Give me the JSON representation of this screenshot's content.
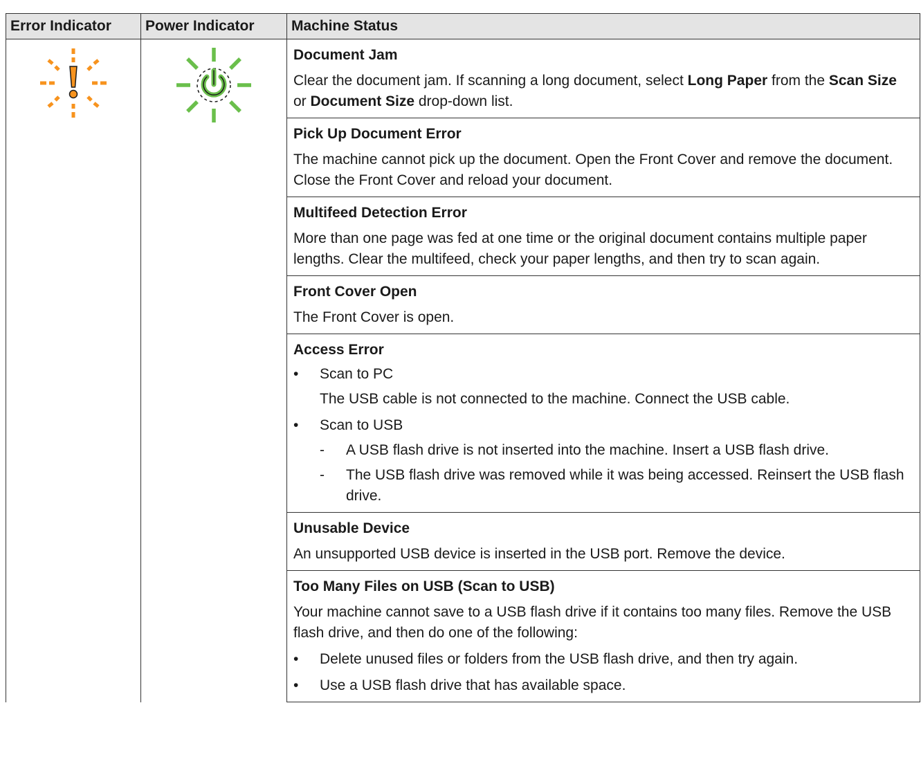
{
  "table": {
    "headers": {
      "error_indicator": "Error Indicator",
      "power_indicator": "Power Indicator",
      "machine_status": "Machine Status"
    },
    "error_icon": {
      "name": "error-indicator-blinking-icon",
      "color": "#f7931e"
    },
    "power_icon": {
      "name": "power-indicator-blinking-icon",
      "color": "#6abf4b"
    },
    "entries": [
      {
        "title": "Document Jam",
        "desc_parts": [
          "Clear the document jam. If scanning a long document, select ",
          "Long Paper",
          " from the ",
          "Scan Size",
          " or ",
          "Document Size",
          " drop-down list."
        ]
      },
      {
        "title": "Pick Up Document Error",
        "desc": "The machine cannot pick up the document. Open the Front Cover and remove the document. Close the Front Cover and reload your document."
      },
      {
        "title": "Multifeed Detection Error",
        "desc": "More than one page was fed at one time or the original document contains multiple paper lengths. Clear the multifeed, check your paper lengths, and then try to scan again."
      },
      {
        "title": "Front Cover Open",
        "desc": "The Front Cover is open."
      },
      {
        "title": "Access Error",
        "bullets": [
          {
            "label": "Scan to PC",
            "text": "The USB cable is not connected to the machine. Connect the USB cable."
          },
          {
            "label": "Scan to USB",
            "subs": [
              "A USB flash drive is not inserted into the machine. Insert a USB flash drive.",
              "The USB flash drive was removed while it was being accessed. Reinsert the USB flash drive."
            ]
          }
        ]
      },
      {
        "title": "Unusable Device",
        "desc": "An unsupported USB device is inserted in the USB port. Remove the device."
      },
      {
        "title": "Too Many Files on USB (Scan to USB)",
        "desc": "Your machine cannot save to a USB flash drive if it contains too many files. Remove the USB flash drive, and then do one of the following:",
        "bullets": [
          "Delete unused files or folders from the USB flash drive, and then try again.",
          "Use a USB flash drive that has available space."
        ]
      }
    ],
    "bullet_char": "•",
    "dash_char": "-"
  }
}
